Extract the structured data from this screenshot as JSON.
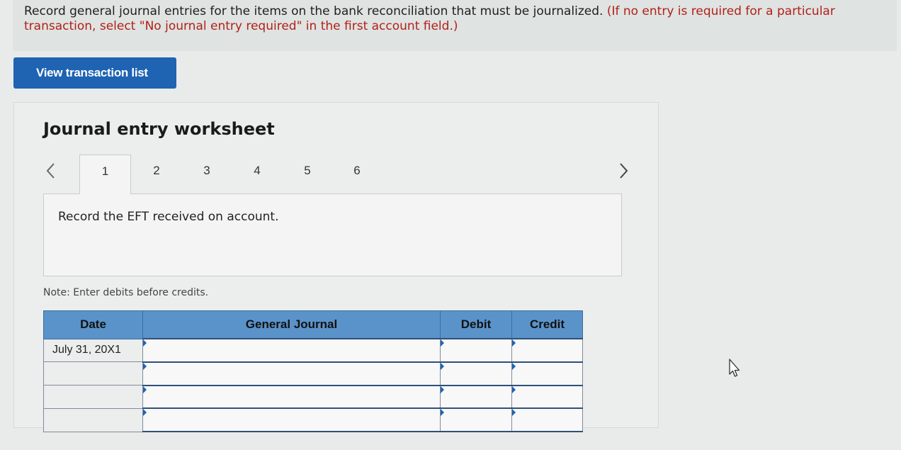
{
  "instructions": {
    "main": "Record general journal entries for the items on the bank reconciliation that must be journalized.",
    "parenthetical": "(If no entry is required for a particular transaction, select \"No journal entry required\" in the first account field.)"
  },
  "view_transaction_button": "View transaction list",
  "worksheet": {
    "title": "Journal entry worksheet",
    "prev_icon": "chevron-left-icon",
    "next_icon": "chevron-right-icon",
    "tabs": [
      "1",
      "2",
      "3",
      "4",
      "5",
      "6"
    ],
    "active_tab": "1",
    "task": "Record the EFT received on account.",
    "note": "Note: Enter debits before credits."
  },
  "journal": {
    "headers": [
      "Date",
      "General Journal",
      "Debit",
      "Credit"
    ],
    "rows": [
      {
        "date": "July 31, 20X1",
        "account": "",
        "debit": "",
        "credit": ""
      },
      {
        "date": "",
        "account": "",
        "debit": "",
        "credit": ""
      },
      {
        "date": "",
        "account": "",
        "debit": "",
        "credit": ""
      },
      {
        "date": "",
        "account": "",
        "debit": "",
        "credit": ""
      }
    ]
  },
  "colors": {
    "button_blue": "#1f63b3",
    "header_blue": "#5a93c9",
    "required_red": "#b2201a"
  }
}
